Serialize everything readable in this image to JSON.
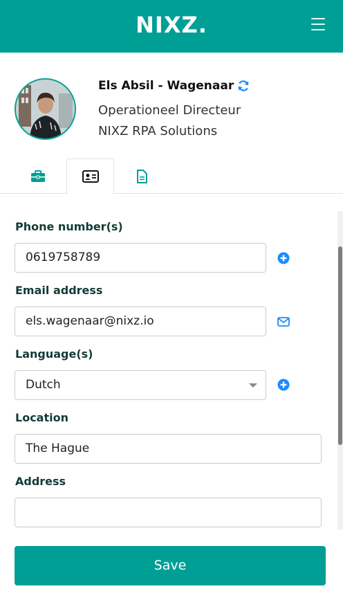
{
  "header": {
    "brand": "NIXZ.",
    "menu_icon": "hamburger-icon"
  },
  "profile": {
    "name": "Els Absil - Wagenaar",
    "role": "Operationeel Directeur",
    "company": "NIXZ RPA Solutions",
    "sync_icon": "refresh-icon"
  },
  "tabs": [
    {
      "icon": "briefcase-icon",
      "active": false
    },
    {
      "icon": "id-card-icon",
      "active": true
    },
    {
      "icon": "document-icon",
      "active": false
    }
  ],
  "form": {
    "phone": {
      "label": "Phone number(s)",
      "value": "0619758789",
      "action_icon": "plus-circle-icon"
    },
    "email": {
      "label": "Email address",
      "value": "els.wagenaar@nixz.io",
      "action_icon": "envelope-icon"
    },
    "language": {
      "label": "Language(s)",
      "value": "Dutch",
      "action_icon": "plus-circle-icon"
    },
    "location": {
      "label": "Location",
      "value": "The Hague"
    },
    "address": {
      "label": "Address",
      "value": ""
    }
  },
  "save_label": "Save",
  "colors": {
    "brand": "#009f95",
    "icon_blue": "#1a8cff",
    "label": "#133b35"
  }
}
